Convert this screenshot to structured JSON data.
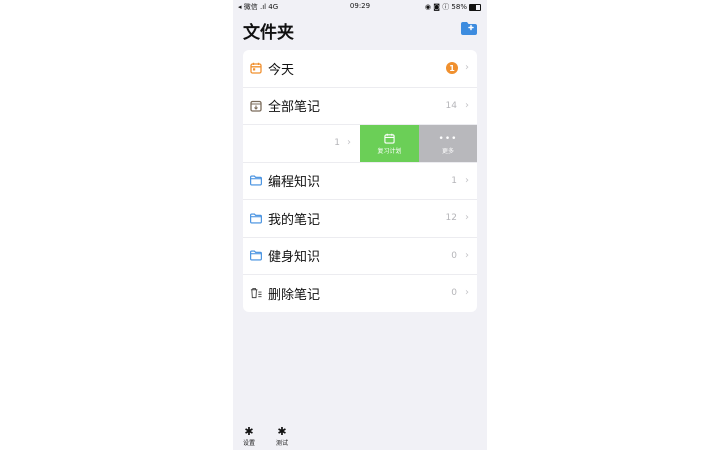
{
  "status": {
    "carrier": "◂ 微信 .ıl 4G",
    "time": "09:29",
    "right": "◉ ◙ ⓘ 58%"
  },
  "header": {
    "title": "文件夹"
  },
  "folders": [
    {
      "label": "今天",
      "badge": "1",
      "icon": "calendar-icon"
    },
    {
      "label": "全部笔记",
      "count": "14",
      "icon": "archive-icon"
    },
    {
      "count": "1",
      "actions": [
        "复习计划",
        "更多"
      ]
    },
    {
      "label": "编程知识",
      "count": "1",
      "icon": "folder-icon"
    },
    {
      "label": "我的笔记",
      "count": "12",
      "icon": "folder-icon"
    },
    {
      "label": "健身知识",
      "count": "0",
      "icon": "folder-icon"
    },
    {
      "label": "删除笔记",
      "count": "0",
      "icon": "trash-icon"
    }
  ],
  "tabbar": {
    "settings": "设置",
    "test": "测试"
  },
  "colors": {
    "accent": "#3d8cdf",
    "green": "#6bcf57",
    "orange": "#f0902f",
    "gray": "#b8b8bc"
  }
}
